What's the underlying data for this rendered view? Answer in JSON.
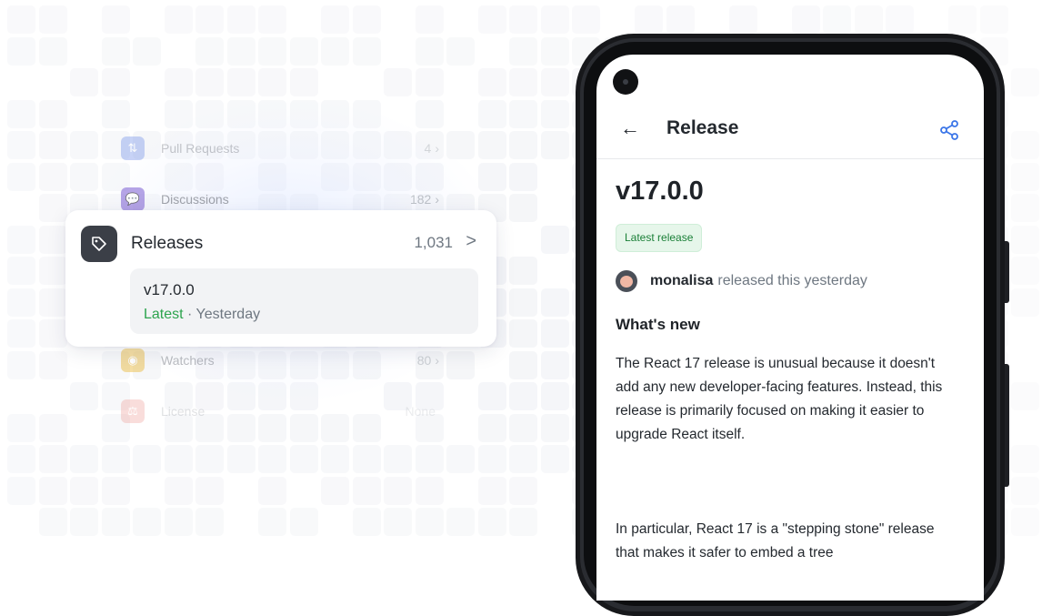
{
  "background_list": [
    {
      "label": "Pull Requests",
      "count": "4",
      "color": "#6f8de8"
    },
    {
      "label": "Discussions",
      "count": "182",
      "color": "#8a6fd8"
    },
    {
      "label": "Watchers",
      "count": "80",
      "color": "#e9b735"
    },
    {
      "label": "License",
      "count": "None",
      "color": "#e65b4f"
    }
  ],
  "releases_card": {
    "title": "Releases",
    "count": "1,031",
    "chevron": ">",
    "latest_version": "v17.0.0",
    "latest_label": "Latest",
    "separator": " · ",
    "when": "Yesterday",
    "icon": "tag-icon"
  },
  "phone_screen": {
    "back_arrow": "←",
    "title": "Release",
    "share_icon": "share-icon",
    "version": "v17.0.0",
    "badge": "Latest release",
    "author": "monalisa",
    "author_suffix": "released this yesterday",
    "section_title": "What's new",
    "paragraph_1": "The React 17 release is unusual because it doesn't add any new developer-facing features. Instead, this release is primarily focused on making it easier to upgrade React itself.",
    "paragraph_2": "In particular, React 17 is a \"stepping stone\" release that makes it safer to embed a tree"
  },
  "colors": {
    "accent_blue": "#3a75e8",
    "success_green": "#2da44e",
    "badge_bg": "#e6f6ea",
    "card_icon_bg": "#3b3f47"
  }
}
